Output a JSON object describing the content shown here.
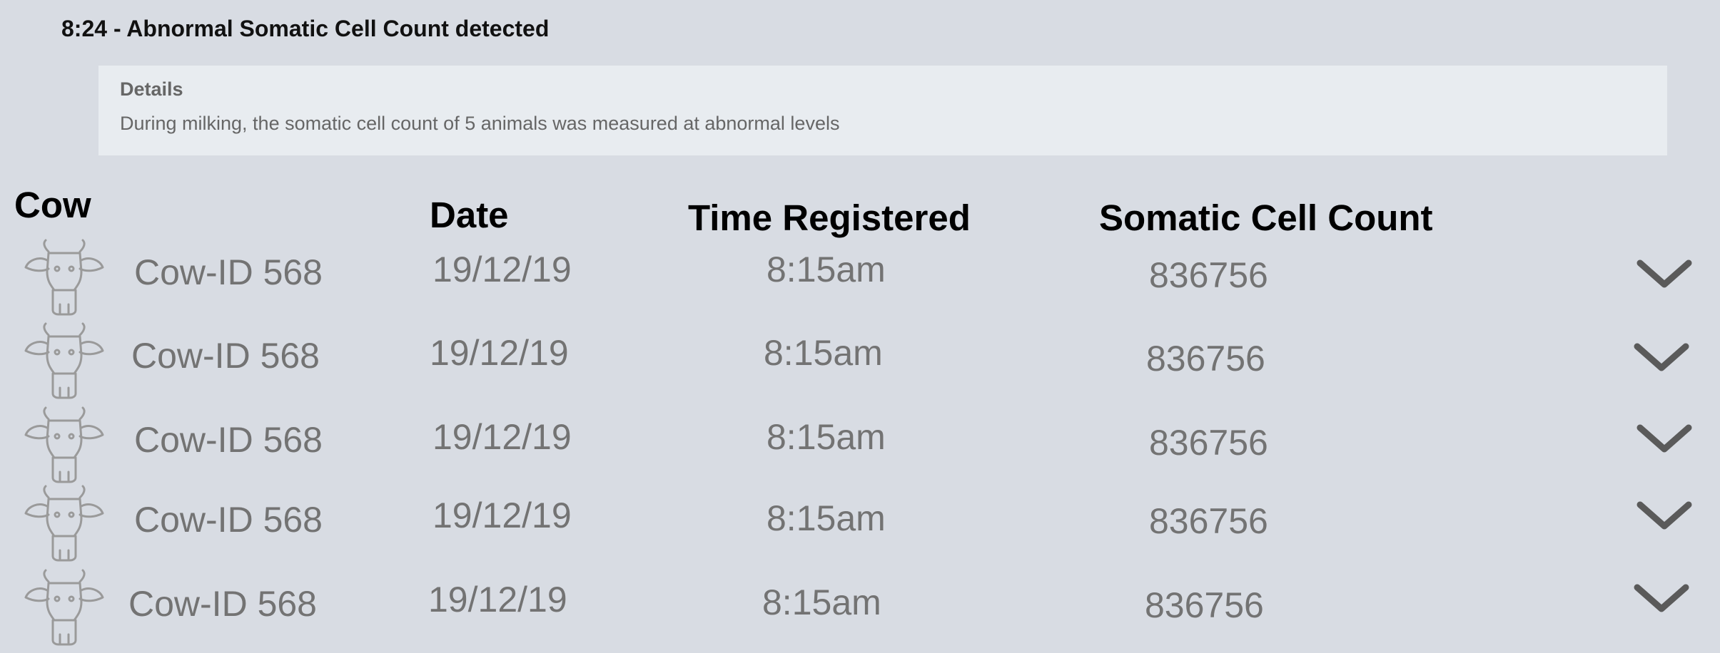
{
  "alert": {
    "title": "8:24 - Abnormal Somatic Cell Count detected",
    "details_label": "Details",
    "details_text": "During milking, the somatic cell count of 5 animals was measured at abnormal levels"
  },
  "table": {
    "headers": {
      "cow": "Cow",
      "date": "Date",
      "time": "Time Registered",
      "scc": "Somatic Cell Count"
    },
    "rows": [
      {
        "cow": "Cow-ID 568",
        "date": "19/12/19",
        "time": "8:15am",
        "scc": "836756"
      },
      {
        "cow": "Cow-ID 568",
        "date": "19/12/19",
        "time": "8:15am",
        "scc": "836756"
      },
      {
        "cow": "Cow-ID 568",
        "date": "19/12/19",
        "time": "8:15am",
        "scc": "836756"
      },
      {
        "cow": "Cow-ID 568",
        "date": "19/12/19",
        "time": "8:15am",
        "scc": "836756"
      },
      {
        "cow": "Cow-ID 568",
        "date": "19/12/19",
        "time": "8:15am",
        "scc": "836756"
      }
    ]
  },
  "icons": {
    "row_icon": "cow-head-icon",
    "expand_icon": "chevron-down-icon"
  },
  "colors": {
    "background": "#d8dce3",
    "details_background": "#e8ecf0",
    "cell_text": "#737373",
    "icon_stroke": "#9a9a9a",
    "chevron": "#5a5a5a"
  }
}
